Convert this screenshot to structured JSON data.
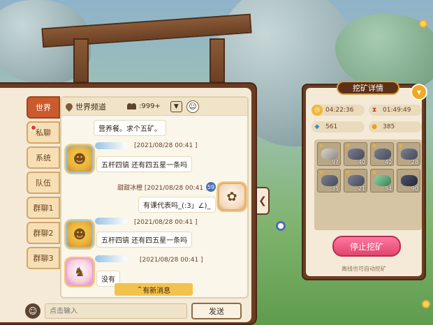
{
  "chat": {
    "tabs": [
      {
        "label": "世界",
        "active": true,
        "dot": false
      },
      {
        "label": "私聊",
        "active": false,
        "dot": true
      },
      {
        "label": "系统",
        "active": false,
        "dot": false
      },
      {
        "label": "队伍",
        "active": false,
        "dot": false
      },
      {
        "label": "群聊1",
        "active": false,
        "dot": false
      },
      {
        "label": "群聊2",
        "active": false,
        "dot": false
      },
      {
        "label": "群聊3",
        "active": false,
        "dot": false
      }
    ],
    "channel": {
      "name": "世界频道",
      "count": ":999+"
    },
    "messages": [
      {
        "meta": "",
        "text": "营养餐。求个五矿。"
      },
      {
        "meta": "[2021/08/28 00:41 ]",
        "text": "五杆四镐 还有四五星一条吗"
      },
      {
        "meta": "甜甜冰橙  [2021/08/28 00:41 ]",
        "text": "有课代表吗_(:3」∠)_",
        "badge": "59"
      },
      {
        "meta": "[2021/08/28 00:41 ]",
        "text": "五杆四镐 还有四五星一条吗"
      },
      {
        "meta": "[2021/08/28 00:41 ]",
        "text": "没有"
      }
    ],
    "new_message_label": "有新消息",
    "input_placeholder": "点击输入",
    "send_label": "发送"
  },
  "mining": {
    "title": "挖矿详情",
    "time_elapsed": "04:22:36",
    "time_remaining": "01:49:49",
    "gems": "561",
    "coins": "385",
    "ores": [
      {
        "type": "grey",
        "count": "97",
        "stars": "★"
      },
      {
        "type": "blue",
        "count": "40",
        "stars": "★"
      },
      {
        "type": "blue",
        "count": "40",
        "stars": "★"
      },
      {
        "type": "blue",
        "count": "28",
        "stars": "★"
      },
      {
        "type": "blue",
        "count": "35",
        "stars": "★"
      },
      {
        "type": "blue",
        "count": "21",
        "stars": "★"
      },
      {
        "type": "green",
        "count": "34",
        "stars": "★"
      },
      {
        "type": "dark",
        "count": "90",
        "stars": ""
      }
    ],
    "stop_label": "停止挖矿",
    "offline_note": "离线也可自动挖矿"
  }
}
